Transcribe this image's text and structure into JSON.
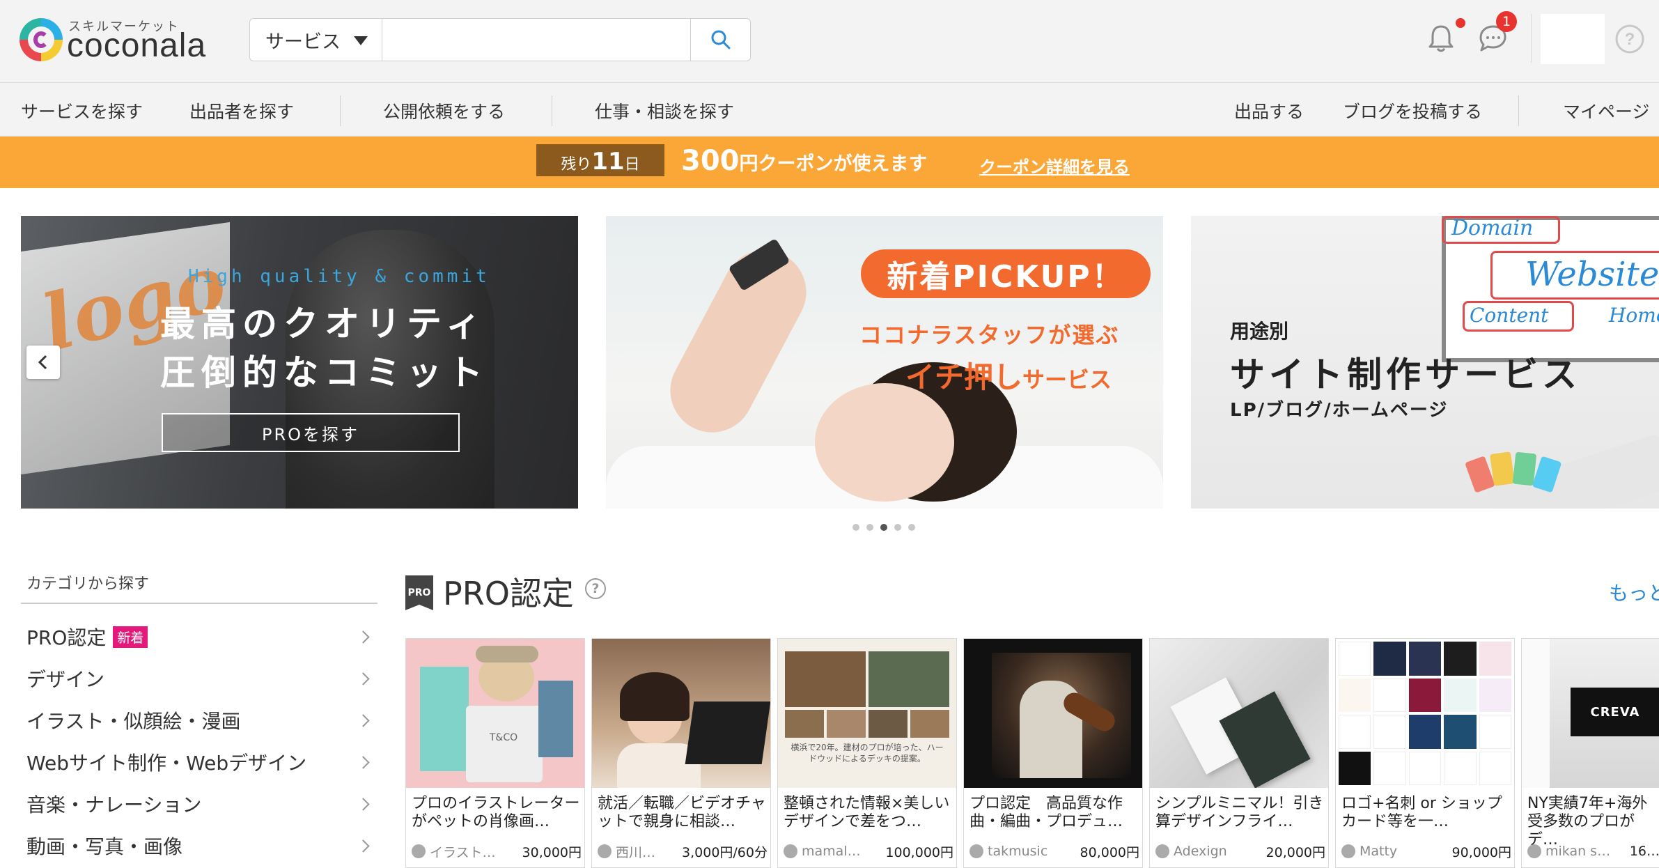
{
  "header": {
    "logo_sub": "スキルマーケット",
    "logo_text": "coconala",
    "search_category": "サービス",
    "search_placeholder": "",
    "message_badge": "1",
    "icons": [
      "search-icon",
      "bell-icon",
      "chat-icon",
      "help-icon"
    ]
  },
  "nav": {
    "left": [
      "サービスを探す",
      "出品者を探す",
      "公開依頼をする",
      "仕事・相談を探す"
    ],
    "right": [
      "出品する",
      "ブログを投稿する",
      "マイページ"
    ]
  },
  "coupon": {
    "days_prefix": "残り",
    "days_number": "11",
    "days_suffix": "日",
    "amount": "300",
    "amount_rest": "円クーポンが使えます",
    "link": "クーポン詳細を見る",
    "color": "#faa737"
  },
  "hero": {
    "slide1": {
      "eyebrow": "High quality & commit",
      "line1": "最高のクオリティ",
      "line2": "圧倒的なコミット",
      "cta": "PROを探す",
      "art_text": "logo"
    },
    "slide2": {
      "badge": "新着PICKUP！",
      "sub1": "ココナラスタッフが選ぶ",
      "sub2_big": "イチ押し",
      "sub2_small": "サービス"
    },
    "slide3": {
      "label": "用途別",
      "title": "サイト制作サービス",
      "sub": "LP/ブログ/ホームページ",
      "words": [
        "Domain",
        "Website",
        "Content",
        "Home"
      ]
    },
    "dots": 5,
    "active_dot": 2
  },
  "sidebar": {
    "heading": "カテゴリから探す",
    "new_tag": "新着",
    "items": [
      "PRO認定",
      "デザイン",
      "イラスト・似顔絵・漫画",
      "Webサイト制作・Webデザイン",
      "音楽・ナレーション",
      "動画・写真・画像"
    ]
  },
  "pro": {
    "badge": "PRO",
    "title": "PRO認定",
    "help": "?",
    "more": "もっと",
    "cards": [
      {
        "title": "プロのイラストレーターがペットの肖像画…",
        "seller": "イラスト…",
        "price": "30,000円"
      },
      {
        "title": "就活／転職／ビデオチャットで親身に相談…",
        "seller": "西川…",
        "price": "3,000円/60分"
      },
      {
        "title": "整頓された情報×美しいデザインで差をつ…",
        "seller": "mamal…",
        "price": "100,000円"
      },
      {
        "title": "プロ認定　高品質な作曲・編曲・プロデュ…",
        "seller": "takmusic",
        "price": "80,000円"
      },
      {
        "title": "シンプルミニマル！引き算デザインフライ…",
        "seller": "Adexign",
        "price": "20,000円"
      },
      {
        "title": "ロゴ+名刺 or ショップカード等を一…",
        "seller": "Matty",
        "price": "90,000円"
      },
      {
        "title": "NY実績7年+海外受多数のプロがデ…",
        "seller": "mikan s…",
        "price": "16…"
      }
    ],
    "card3_headline": "横浜で20年。建材のプロが培った、ハードウッドによるデッキの提案。",
    "card7_brand": "CREVA",
    "card1_tag": "T&CO"
  }
}
